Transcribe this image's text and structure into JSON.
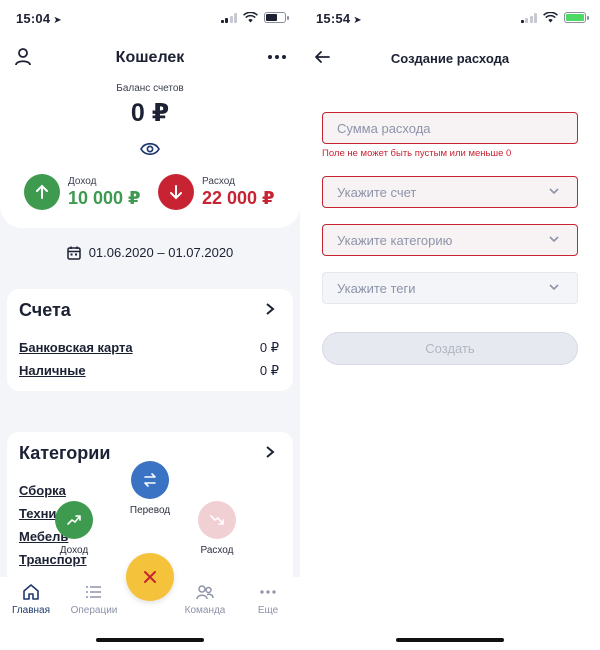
{
  "left": {
    "status": {
      "time": "15:04"
    },
    "header": {
      "title": "Кошелек"
    },
    "balance": {
      "label": "Баланс счетов",
      "value": "0 ₽"
    },
    "income": {
      "label": "Доход",
      "value": "10 000 ₽",
      "color": "#3d9a4f"
    },
    "expense": {
      "label": "Расход",
      "value": "22 000 ₽",
      "color": "#c82333"
    },
    "period": "01.06.2020 – 01.07.2020",
    "accounts": {
      "title": "Счета",
      "items": [
        {
          "name": "Банковская карта",
          "value": "0 ₽"
        },
        {
          "name": "Наличные",
          "value": "0 ₽"
        }
      ]
    },
    "categories": {
      "title": "Категории",
      "items": [
        "Сборка",
        "Техни",
        "Мебель",
        "Транспорт"
      ]
    },
    "fab_menu": {
      "transfer_label": "Перевод",
      "income_label": "Доход",
      "expense_label": "Расход",
      "transfer_color": "#3a72c4",
      "income_color": "#3d9a4f",
      "expense_color": "#f1d0d3",
      "close_color": "#f5c33b"
    },
    "tabs": [
      "Главная",
      "Операции",
      "Команда",
      "Еще"
    ]
  },
  "right": {
    "status": {
      "time": "15:54"
    },
    "header": {
      "title": "Создание расхода"
    },
    "amount_placeholder": "Сумма расхода",
    "amount_error": "Поле не может быть пустым или меньше 0",
    "account_placeholder": "Укажите счет",
    "category_placeholder": "Укажите категорию",
    "tags_placeholder": "Укажите теги",
    "create_label": "Создать"
  }
}
